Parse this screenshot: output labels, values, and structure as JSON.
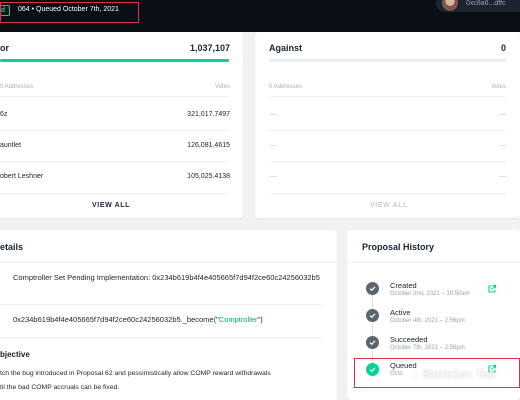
{
  "header": {
    "status_badge": "ed",
    "status_text": "064 • Queued October 7th, 2021",
    "user_address": "0xc8a6...dffc"
  },
  "colors": {
    "accent_green": "#00d395",
    "highlight_red": "#e0323c",
    "topbar_bg": "#0a0f16"
  },
  "votes_for": {
    "title": "or",
    "total": "1,037,107",
    "progress_fraction": 1.0,
    "col_addresses": "0 Addresses",
    "col_votes": "Votes",
    "rows": [
      {
        "voter": "6z",
        "votes": "321,017.7497"
      },
      {
        "voter": "auntlet",
        "votes": "126,081.4615"
      },
      {
        "voter": "obert Leshner",
        "votes": "105,025.4138"
      }
    ],
    "view_all": "VIEW ALL"
  },
  "votes_against": {
    "title": "Against",
    "total": "0",
    "progress_fraction": 0,
    "col_addresses": "0 Addresses",
    "col_votes": "Votes",
    "rows": [
      {
        "voter": "—",
        "votes": "—"
      },
      {
        "voter": "—",
        "votes": "—"
      },
      {
        "voter": "—",
        "votes": "—"
      }
    ],
    "view_all": "VIEW ALL"
  },
  "details": {
    "title": "etails",
    "action1": "Comptroller Set Pending Implementation: 0x234b619b4f4e405665f7d94f2ce60c24256032b5",
    "action2_prefix": "0x234b619b4f4e405665f7d94f2ce60c24256032b5._become(\"",
    "action2_arg": "Comptroller",
    "action2_suffix": "\")",
    "objective_title": "bjective",
    "objective_line1": "tch the bug introduced in Proposal 62 and pessimistically allow COMP reward withdrawals",
    "objective_line2": "til the bad COMP accruals can be fixed."
  },
  "history": {
    "title": "Proposal History",
    "items": [
      {
        "name": "Created",
        "date": "October 2nd, 2021 – 10:50am"
      },
      {
        "name": "Active",
        "date": "October 4th, 2021 – 2:56pm"
      },
      {
        "name": "Succeeded",
        "date": "October 7th, 2021 – 2:56pm"
      },
      {
        "name": "Queued",
        "date": "Octo"
      }
    ]
  },
  "watermark": "BlockSec Tea"
}
